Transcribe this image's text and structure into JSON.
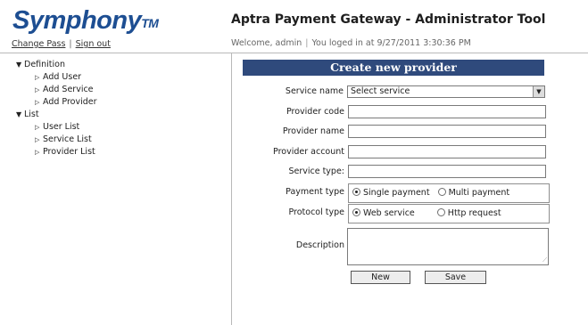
{
  "brand": {
    "logo_text": "Symphony",
    "logo_tm": "TM"
  },
  "auth": {
    "change_pass": "Change Pass",
    "sign_out": "Sign out",
    "separator": "|"
  },
  "header": {
    "title": "Aptra Payment Gateway - Administrator Tool",
    "welcome": "Welcome, admin",
    "separator": "|",
    "login_info": "You loged in at 9/27/2011 3:30:36 PM"
  },
  "tree": {
    "definition": {
      "label": "Definition",
      "items": [
        "Add User",
        "Add Service",
        "Add Provider"
      ]
    },
    "list": {
      "label": "List",
      "items": [
        "User List",
        "Service List",
        "Provider List"
      ]
    }
  },
  "form": {
    "title": "Create new provider",
    "service_name_label": "Service name",
    "service_name_value": "Select service",
    "provider_code_label": "Provider code",
    "provider_name_label": "Provider name",
    "provider_account_label": "Provider account",
    "service_type_label": "Service type:",
    "payment_type_label": "Payment type",
    "payment_options": {
      "single": "Single payment",
      "multi": "Multi payment",
      "selected": "single"
    },
    "protocol_type_label": "Protocol type",
    "protocol_options": {
      "web": "Web service",
      "http": "Http request",
      "selected": "web"
    },
    "description_label": "Description",
    "new_button": "New",
    "save_button": "Save"
  },
  "colors": {
    "brand_blue": "#1d4e92",
    "panel_header": "#2f4a7c"
  }
}
